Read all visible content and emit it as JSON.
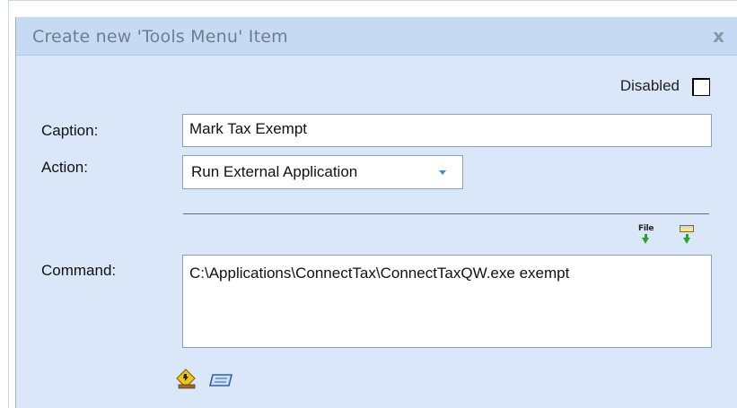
{
  "dialog": {
    "title": "Create new 'Tools Menu' Item",
    "close_label": "x",
    "disabled_label": "Disabled",
    "disabled_checked": false
  },
  "form": {
    "caption_label": "Caption:",
    "caption_value": "Mark Tax Exempt",
    "action_label": "Action:",
    "action_value": "Run External Application",
    "command_label": "Command:",
    "command_value": "C:\\Applications\\ConnectTax\\ConnectTaxQW.exe exempt"
  },
  "toolbar": {
    "file_icon_text": "File",
    "icons": [
      "file-insert-icon",
      "folder-insert-icon",
      "wizard-icon",
      "keyboard-icon"
    ]
  },
  "colors": {
    "dialog_bg": "#dae7f8",
    "title_bg": "#c7daf3",
    "accent_arrow": "#2aa12a"
  }
}
